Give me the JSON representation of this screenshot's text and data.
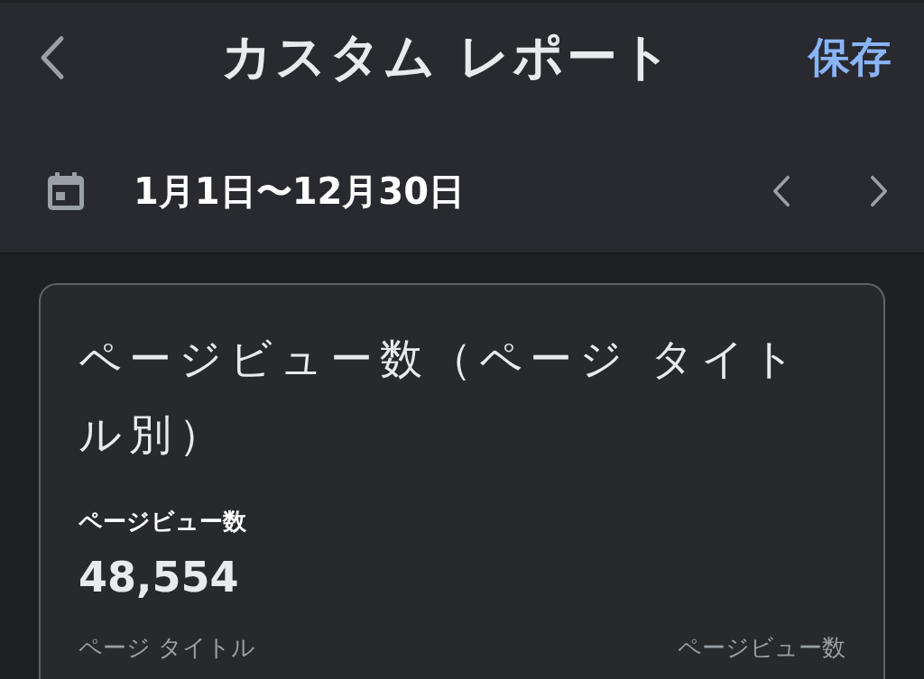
{
  "header": {
    "title": "カスタム レポート",
    "save": "保存"
  },
  "date_range": {
    "label": "1月1日〜12月30日"
  },
  "card": {
    "title": "ページビュー数（ページ タイトル別）",
    "metric_label": "ページビュー数",
    "metric_value": "48,554",
    "columns": [
      "ページ タイトル",
      "ページビュー数"
    ]
  }
}
